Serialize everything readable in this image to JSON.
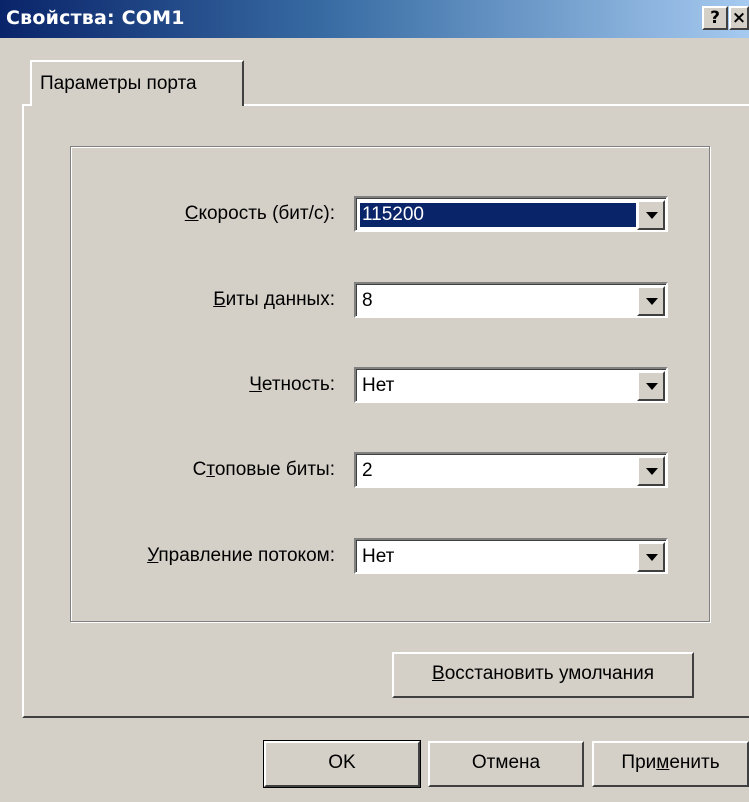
{
  "window": {
    "title": "Свойства: COM1",
    "help_glyph": "?",
    "close_glyph": "×"
  },
  "tabs": [
    {
      "label": "Параметры порта"
    }
  ],
  "settings": [
    {
      "label_access": "С",
      "label_rest": "корость (бит/с):",
      "value": "115200",
      "selected": true
    },
    {
      "label_access": "Б",
      "label_rest": "иты данных:",
      "value": "8",
      "selected": false
    },
    {
      "label_access": "Ч",
      "label_rest": "етность:",
      "value": "Нет",
      "selected": false
    },
    {
      "label_pre": "С",
      "label_access": "т",
      "label_rest": "оповые биты:",
      "value": "2",
      "selected": false
    },
    {
      "label_access": "У",
      "label_rest": "правление потоком:",
      "value": "Нет",
      "selected": false
    }
  ],
  "restore_button": {
    "access": "В",
    "rest": "осстановить умолчания"
  },
  "footer": {
    "ok_label": "OK",
    "cancel_label": "Отмена",
    "apply_pre": "При",
    "apply_access": "м",
    "apply_rest": "енить"
  },
  "colors": {
    "title_bar_start": "#0a246a",
    "title_bar_end": "#a6caf0",
    "face": "#d4d0c8",
    "selection": "#0a246a"
  }
}
